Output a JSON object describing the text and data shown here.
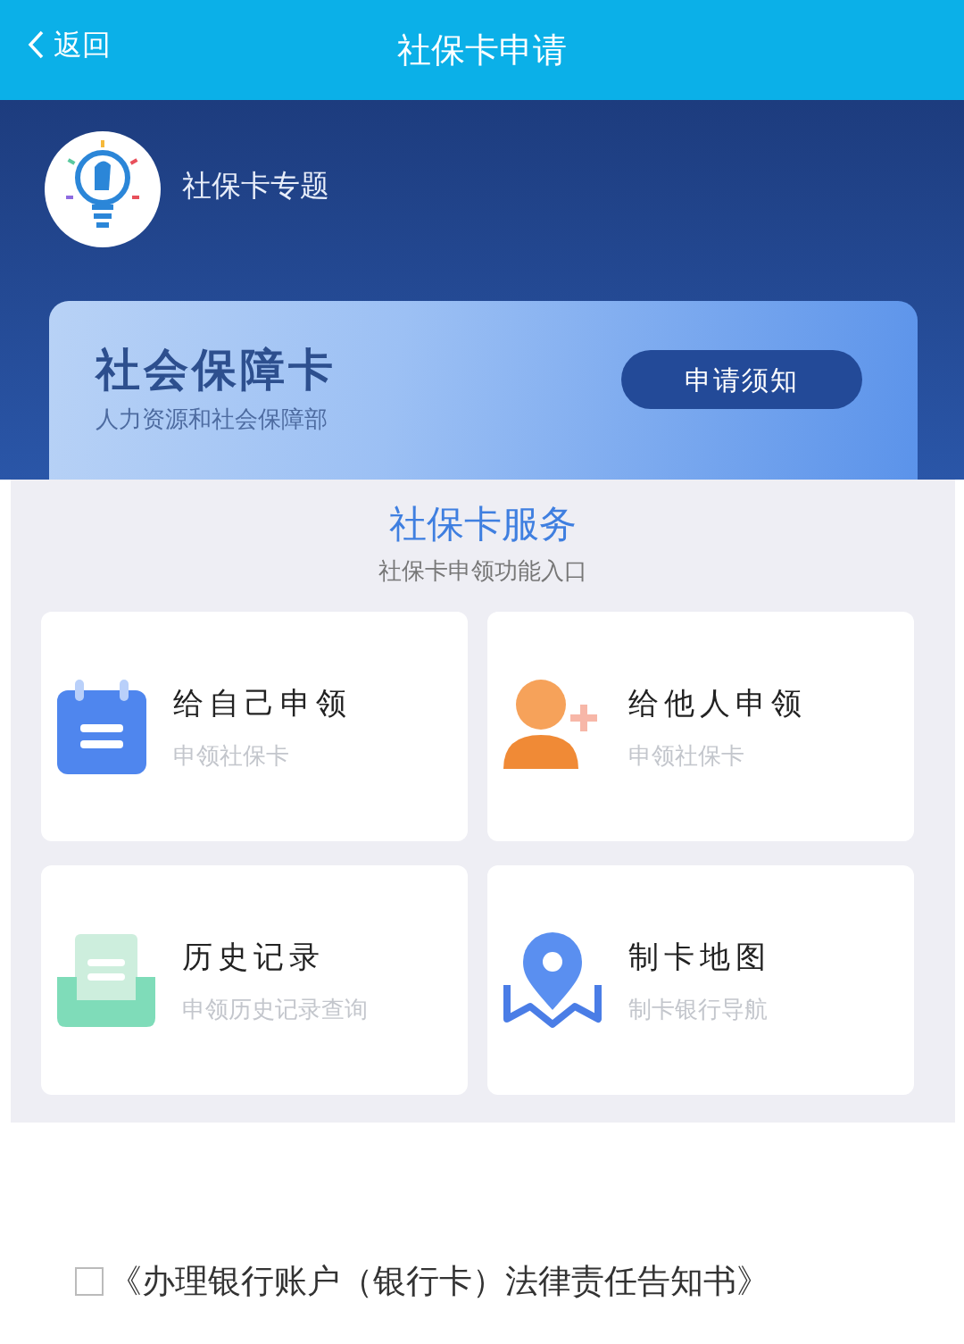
{
  "header": {
    "back_label": "返回",
    "title": "社保卡申请"
  },
  "profile": {
    "subtitle": "社保卡专题"
  },
  "banner": {
    "title": "社会保障卡",
    "subtitle": "人力资源和社会保障部",
    "button": "申请须知"
  },
  "services": {
    "title": "社保卡服务",
    "subtitle": "社保卡申领功能入口",
    "items": [
      {
        "kind": "calendar",
        "title": "给自己申领",
        "subtitle": "申领社保卡"
      },
      {
        "kind": "person-add",
        "title": "给他人申领",
        "subtitle": "申领社保卡"
      },
      {
        "kind": "tray",
        "title": "历史记录",
        "subtitle": "申领历史记录查询"
      },
      {
        "kind": "map-pin",
        "title": "制卡地图",
        "subtitle": "制卡银行导航"
      }
    ]
  },
  "agreement": {
    "checked": false,
    "text": "《办理银行账户（银行卡）法律责任告知书》"
  }
}
